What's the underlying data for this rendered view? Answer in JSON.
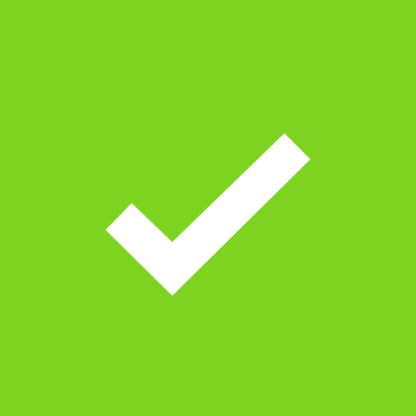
{
  "background": {
    "color": "#7ED321"
  },
  "icon": {
    "name": "checkmark-icon",
    "color": "#FFFFFF"
  }
}
